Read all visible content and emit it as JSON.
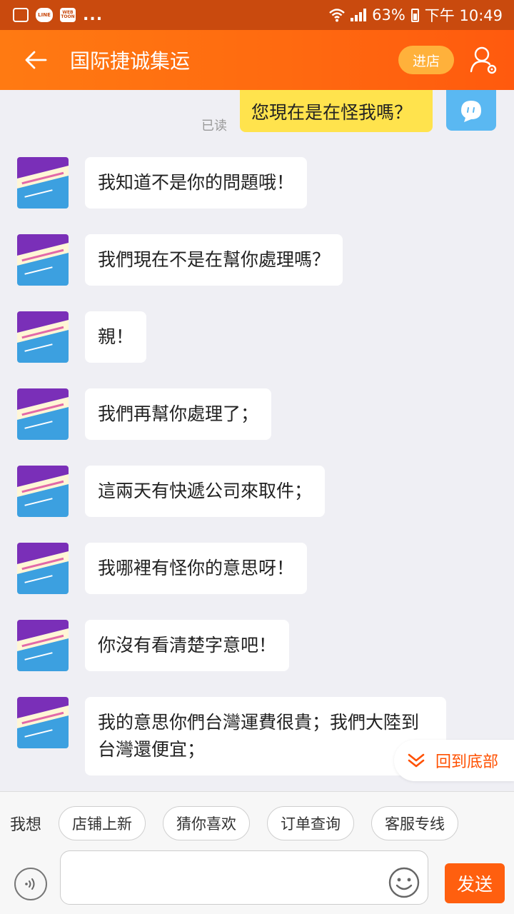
{
  "status_bar": {
    "icons": [
      "gallery-icon",
      "line-icon",
      "webtoon-icon"
    ],
    "line_text": "LINE",
    "webtoon_text": "WEB TOON",
    "overflow": "...",
    "battery": "63%",
    "time": "下午 10:49"
  },
  "header": {
    "title": "国际捷诚集运",
    "store_button": "进店"
  },
  "chat": {
    "my_message": "您現在是在怪我嗎？",
    "read_status": "已读",
    "messages": [
      "我知道不是你的問題哦！",
      "我們現在不是在幫你處理嗎？",
      "親！",
      "我們再幫你處理了；",
      "這兩天有快遞公司來取件；",
      "我哪裡有怪你的意思呀！",
      "你沒有看清楚字意吧！",
      "我的意思你們台灣運費很貴；我們大陸到台灣還便宜；"
    ]
  },
  "back_to_bottom": "回到底部",
  "input_panel": {
    "wish_label": "我想",
    "quick_replies": [
      "店铺上新",
      "猜你喜欢",
      "订单查询",
      "客服专线"
    ],
    "input_value": "",
    "send_label": "发送"
  },
  "colors": {
    "status_bar": "#c94a0e",
    "nav_start": "#ff7a12",
    "nav_end": "#ff5a0e",
    "my_bubble": "#ffe34d",
    "accent": "#ff5000"
  }
}
